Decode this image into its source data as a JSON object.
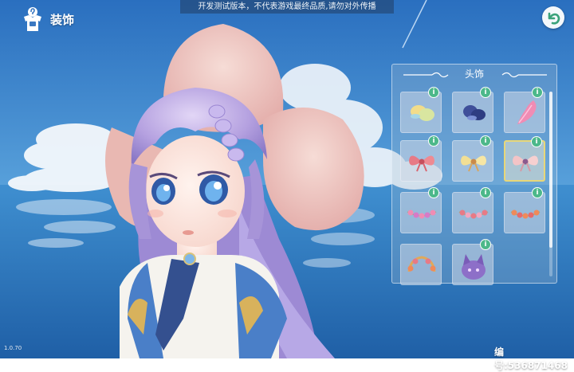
{
  "notice": "开发测试版本，不代表游戏最终品质,请勿对外传播",
  "header": {
    "title": "装饰",
    "title_icon": "wardrobe-icon",
    "back_icon": "back-arrow-icon"
  },
  "panel": {
    "title": "头饰",
    "items": [
      {
        "name": "yellow-bun-ornament",
        "icon": "yellow-bun-icon",
        "selected": false
      },
      {
        "name": "navy-bun-ornament",
        "icon": "navy-bun-icon",
        "selected": false
      },
      {
        "name": "pink-feather-clip",
        "icon": "pink-feather-icon",
        "selected": false
      },
      {
        "name": "red-bow",
        "icon": "red-bow-icon",
        "selected": false
      },
      {
        "name": "yellow-bow",
        "icon": "yellow-bow-icon",
        "selected": false
      },
      {
        "name": "pink-bow",
        "icon": "pink-bow-icon",
        "selected": true
      },
      {
        "name": "pink-flower-garland",
        "icon": "pink-garland-icon",
        "selected": false
      },
      {
        "name": "rose-flower-garland",
        "icon": "rose-garland-icon",
        "selected": false
      },
      {
        "name": "orange-flower-garland",
        "icon": "orange-garland-icon",
        "selected": false
      },
      {
        "name": "flower-crown",
        "icon": "flower-crown-icon",
        "selected": false
      },
      {
        "name": "purple-cat-ears",
        "icon": "cat-ears-icon",
        "selected": false
      }
    ]
  },
  "footer": {
    "version": "1.0.70",
    "id_label": "编号:536871468"
  },
  "colors": {
    "sky": "#3d86cf",
    "panel_border": "#eaf2fa",
    "info_badge": "#4cb88a",
    "selected_border": "#e8d778"
  }
}
